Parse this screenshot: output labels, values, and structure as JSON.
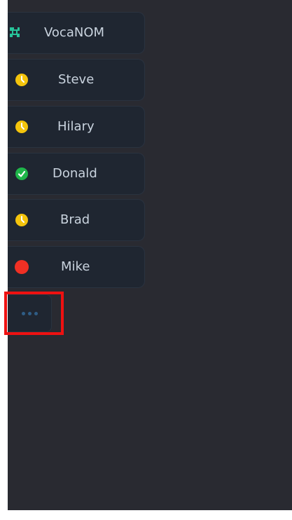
{
  "sidebar": {
    "items": [
      {
        "label": "VocaNOM",
        "icon": "app-logo-icon",
        "color": "#27c39a"
      },
      {
        "label": "Steve",
        "icon": "clock-pending-icon",
        "color": "#f4c40c"
      },
      {
        "label": "Hilary",
        "icon": "clock-pending-icon",
        "color": "#f4c40c"
      },
      {
        "label": "Donald",
        "icon": "check-circle-icon",
        "color": "#1fb64a"
      },
      {
        "label": "Brad",
        "icon": "clock-pending-icon",
        "color": "#f4c40c"
      },
      {
        "label": "Mike",
        "icon": "red-dot-icon",
        "color": "#f03024"
      }
    ],
    "more_icon": "more-dots-icon"
  },
  "colors": {
    "background": "#292a31",
    "item_background": "#1f2631",
    "highlight": "#ee1111"
  }
}
